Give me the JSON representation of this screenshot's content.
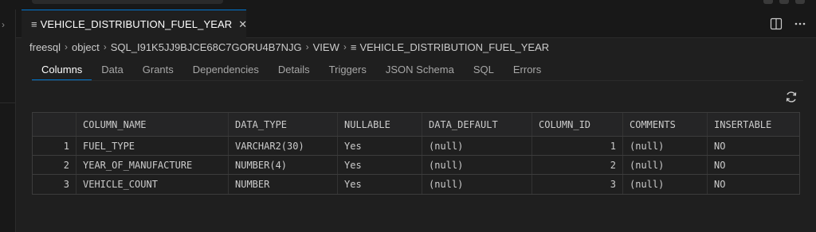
{
  "editor": {
    "tab_title": "VEHICLE_DISTRIBUTION_FUEL_YEAR",
    "tab_icon": "list-icon"
  },
  "breadcrumb": [
    "freesql",
    "object",
    "SQL_I91K5JJ9BJCE68C7GORU4B7NJG",
    "VIEW",
    "VEHICLE_DISTRIBUTION_FUEL_YEAR"
  ],
  "subtabs": [
    "Columns",
    "Data",
    "Grants",
    "Dependencies",
    "Details",
    "Triggers",
    "JSON Schema",
    "SQL",
    "Errors"
  ],
  "active_subtab": "Columns",
  "table": {
    "columns": [
      "",
      "COLUMN_NAME",
      "DATA_TYPE",
      "NULLABLE",
      "DATA_DEFAULT",
      "COLUMN_ID",
      "COMMENTS",
      "INSERTABLE"
    ],
    "rows": [
      [
        "1",
        "FUEL_TYPE",
        "VARCHAR2(30)",
        "Yes",
        "(null)",
        "1",
        "(null)",
        "NO"
      ],
      [
        "2",
        "YEAR_OF_MANUFACTURE",
        "NUMBER(4)",
        "Yes",
        "(null)",
        "2",
        "(null)",
        "NO"
      ],
      [
        "3",
        "VEHICLE_COUNT",
        "NUMBER",
        "Yes",
        "(null)",
        "3",
        "(null)",
        "NO"
      ]
    ]
  },
  "colors": {
    "accent": "#0078d4",
    "background": "#1f1f1f",
    "tabbar": "#181818"
  }
}
